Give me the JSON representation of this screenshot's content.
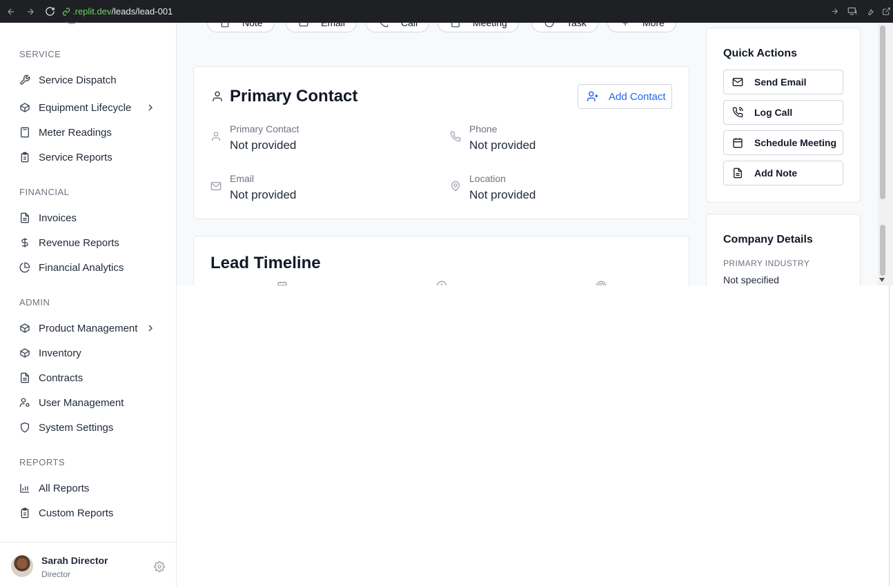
{
  "browser": {
    "url_domain": ".replit.dev",
    "url_path": "/leads/lead-001"
  },
  "sidebar": {
    "sections": [
      {
        "title": "SERVICE",
        "items": [
          {
            "label": "Service Dispatch",
            "icon": "wrench-icon"
          },
          {
            "label": "Equipment Lifecycle",
            "icon": "box-icon",
            "expandable": true
          },
          {
            "label": "Meter Readings",
            "icon": "calculator-icon"
          },
          {
            "label": "Service Reports",
            "icon": "clipboard-icon"
          }
        ]
      },
      {
        "title": "FINANCIAL",
        "items": [
          {
            "label": "Invoices",
            "icon": "file-icon"
          },
          {
            "label": "Revenue Reports",
            "icon": "dollar-icon"
          },
          {
            "label": "Financial Analytics",
            "icon": "pie-chart-icon"
          }
        ]
      },
      {
        "title": "ADMIN",
        "items": [
          {
            "label": "Product Management",
            "icon": "box-icon",
            "expandable": true
          },
          {
            "label": "Inventory",
            "icon": "box-icon"
          },
          {
            "label": "Contracts",
            "icon": "file-icon"
          },
          {
            "label": "User Management",
            "icon": "user-cog-icon"
          },
          {
            "label": "System Settings",
            "icon": "shield-icon"
          }
        ]
      },
      {
        "title": "REPORTS",
        "items": [
          {
            "label": "All Reports",
            "icon": "bar-chart-icon"
          },
          {
            "label": "Custom Reports",
            "icon": "clipboard-icon"
          }
        ]
      }
    ],
    "profile": {
      "name": "Sarah Director",
      "role": "Director"
    }
  },
  "activity_pills": [
    "Note",
    "Email",
    "Call",
    "Meeting",
    "Task",
    "More"
  ],
  "primary_contact": {
    "title": "Primary Contact",
    "add_button": "Add Contact",
    "fields": [
      {
        "label": "Primary Contact",
        "value": "Not provided",
        "icon": "user-icon"
      },
      {
        "label": "Phone",
        "value": "Not provided",
        "icon": "phone-icon"
      },
      {
        "label": "Email",
        "value": "Not provided",
        "icon": "mail-icon"
      },
      {
        "label": "Location",
        "value": "Not provided",
        "icon": "map-pin-icon"
      }
    ]
  },
  "timeline": {
    "title": "Lead Timeline"
  },
  "quick_actions": {
    "title": "Quick Actions",
    "buttons": [
      {
        "label": "Send Email",
        "icon": "mail-icon"
      },
      {
        "label": "Log Call",
        "icon": "phone-call-icon"
      },
      {
        "label": "Schedule Meeting",
        "icon": "calendar-icon"
      },
      {
        "label": "Add Note",
        "icon": "file-text-icon"
      }
    ]
  },
  "company_details": {
    "title": "Company Details",
    "primary_industry_label": "PRIMARY INDUSTRY",
    "primary_industry_value": "Not specified"
  }
}
